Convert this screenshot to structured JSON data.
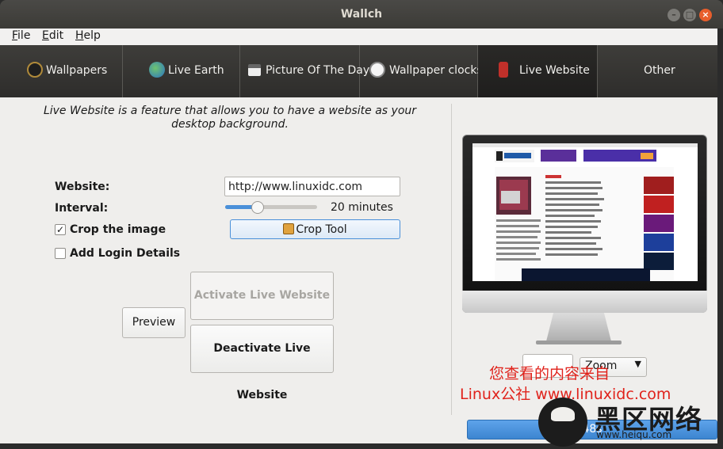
{
  "window": {
    "title": "Wallch"
  },
  "menu": [
    "File",
    "Edit",
    "Help"
  ],
  "tabs": [
    {
      "label": "Wallpapers",
      "icon": "wallpapers-icon"
    },
    {
      "label": "Live Earth",
      "icon": "earth-icon"
    },
    {
      "label": "Picture Of The Day",
      "icon": "calendar-icon"
    },
    {
      "label": "Wallpaper clocks",
      "icon": "clock-icon"
    },
    {
      "label": "Live Website",
      "icon": "broadcast-icon",
      "active": true
    },
    {
      "label": "Other"
    }
  ],
  "live_website": {
    "description": "Live Website is a feature that allows you to have a website as your desktop background.",
    "website_label": "Website:",
    "website_value": "http://www.linuxidc.com",
    "interval_label": "Interval:",
    "interval_value": "20 minutes",
    "interval_slider_fraction": 0.35,
    "crop_label": "Crop the image",
    "crop_checked": true,
    "crop_tool_label": "Crop Tool",
    "login_label": "Add Login Details",
    "login_checked": false,
    "preview_label": "Preview",
    "activate_label": "Activate Live Website",
    "deactivate_label": "Deactivate Live Website"
  },
  "preview": {
    "zoom_value": "Zoom",
    "progress_text": "48s",
    "progress_fraction": 1.0
  },
  "watermarks": {
    "line1": "您查看的内容来自",
    "line2": "Linux公社 www.linuxidc.com",
    "logo_text": "黑区网络",
    "logo_url": "www.heiqu.com"
  },
  "colors": {
    "accent": "#4a90d9",
    "titlebar": "#3c3b37",
    "watermark": "#e0221b"
  }
}
